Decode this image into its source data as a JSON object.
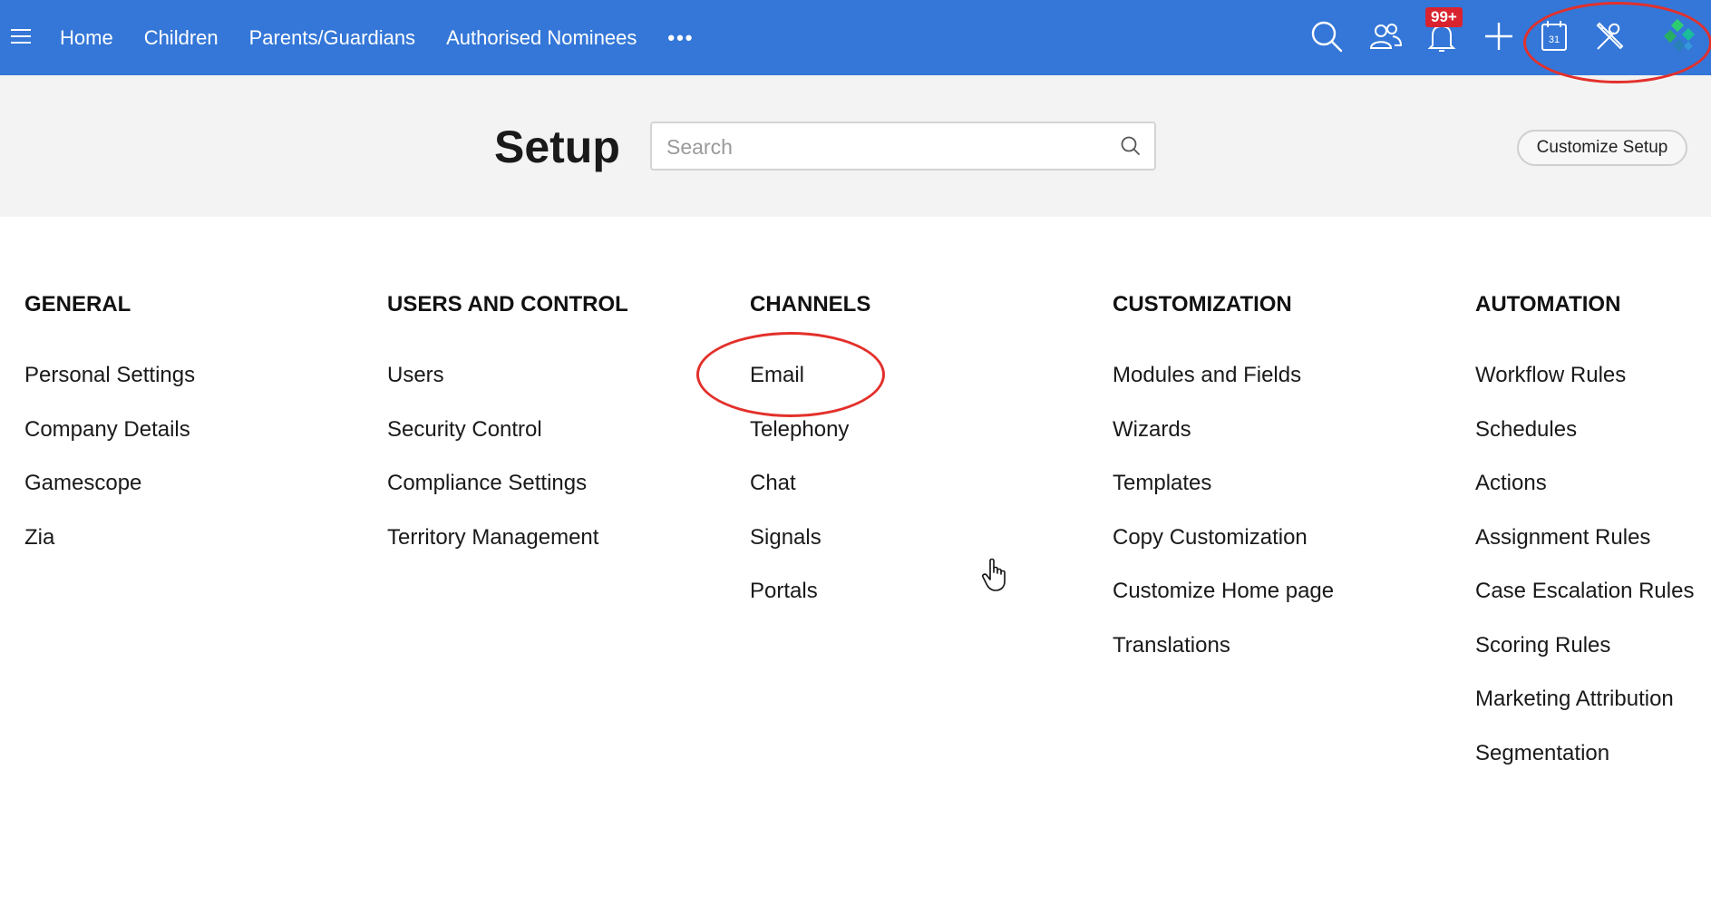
{
  "nav": {
    "items": [
      "Home",
      "Children",
      "Parents/Guardians",
      "Authorised Nominees"
    ],
    "more": "•••",
    "notification_badge": "99+",
    "icons": [
      "menu-icon",
      "search-icon",
      "people-icon",
      "bell-icon",
      "plus-icon",
      "calendar-icon",
      "setup-tools-icon",
      "app-logo-icon"
    ],
    "accent": "#3477d8",
    "calendar_day": "31"
  },
  "header": {
    "title": "Setup",
    "search_placeholder": "Search",
    "customize_button": "Customize Setup"
  },
  "columns": [
    {
      "heading": "GENERAL",
      "items": [
        "Personal Settings",
        "Company Details",
        "Gamescope",
        "Zia"
      ]
    },
    {
      "heading": "USERS AND CONTROL",
      "items": [
        "Users",
        "Security Control",
        "Compliance Settings",
        "Territory Management"
      ]
    },
    {
      "heading": "CHANNELS",
      "items": [
        "Email",
        "Telephony",
        "Chat",
        "Signals",
        "Portals"
      ]
    },
    {
      "heading": "CUSTOMIZATION",
      "items": [
        "Modules and Fields",
        "Wizards",
        "Templates",
        "Copy Customization",
        "Customize Home page",
        "Translations"
      ]
    },
    {
      "heading": "AUTOMATION",
      "items": [
        "Workflow Rules",
        "Schedules",
        "Actions",
        "Assignment Rules",
        "Case Escalation Rules",
        "Scoring Rules",
        "Marketing Attribution",
        "Segmentation"
      ]
    }
  ]
}
